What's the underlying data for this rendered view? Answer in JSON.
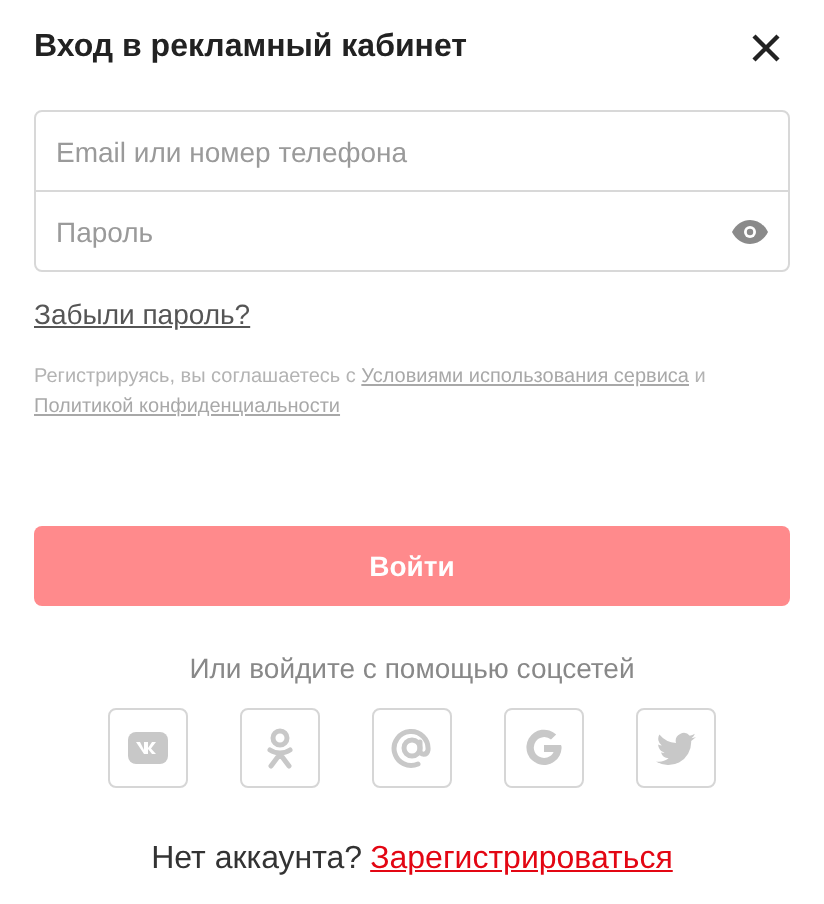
{
  "title": "Вход в рекламный кабинет",
  "fields": [
    {
      "placeholder": "Email или номер телефона",
      "kind": "text"
    },
    {
      "placeholder": "Пароль",
      "kind": "password"
    }
  ],
  "forgot_link": "Забыли пароль?",
  "terms": {
    "text_before": "Регистрируясь, вы соглашаетесь с",
    "link_1": "Условиями использования сервиса",
    "text_middle": "и",
    "link_2": "Политикой конфиденциальности"
  },
  "submit_button": {
    "label": "Войти",
    "disabled": true
  },
  "social_caption": "Или войдите с помощью соцсетей",
  "social": [
    {
      "kind": "vk"
    },
    {
      "kind": "ok"
    },
    {
      "kind": "mail"
    },
    {
      "kind": "google"
    },
    {
      "kind": "twitter"
    }
  ],
  "signup": {
    "text": "Нет аккаунта?",
    "link": "Зарегистрироваться"
  }
}
